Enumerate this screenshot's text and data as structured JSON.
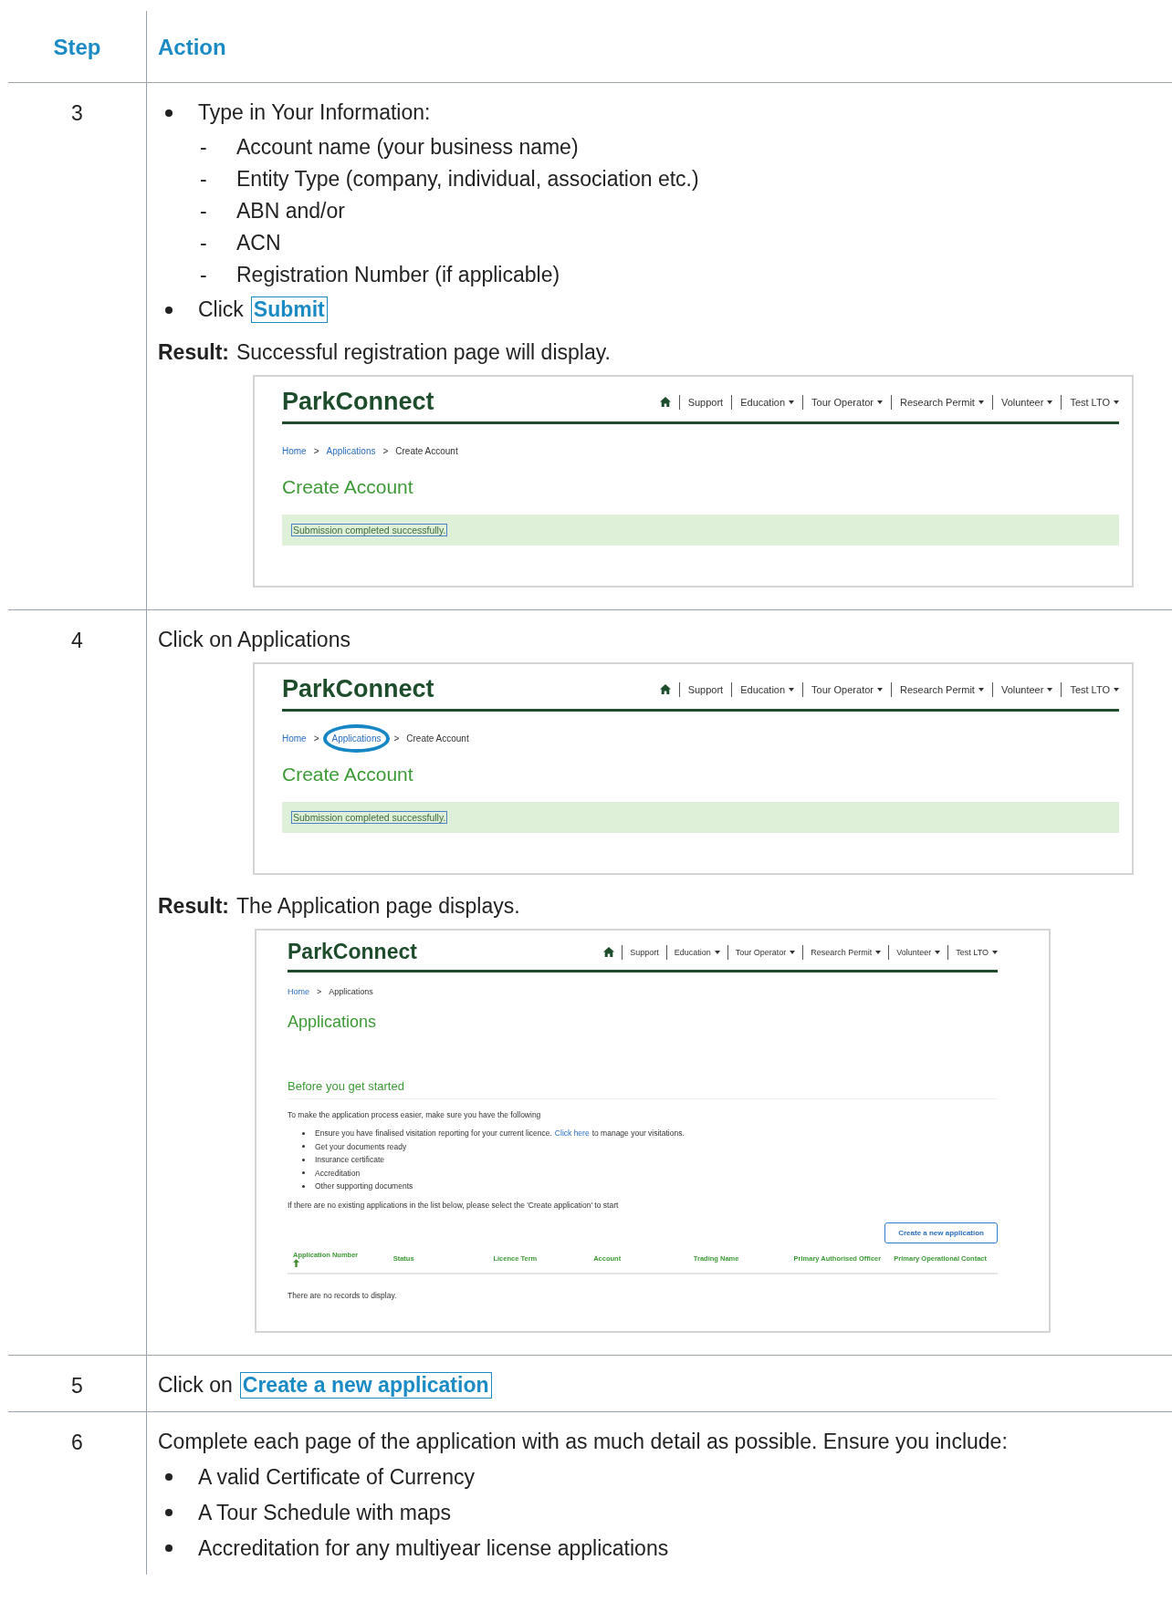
{
  "table": {
    "columns": [
      "Step",
      "Action"
    ],
    "rows": [
      {
        "step": "3",
        "blocks": [
          {
            "kind": "bullet",
            "text": "Type in Your Information:"
          },
          {
            "kind": "sublist",
            "marker": "-",
            "items": [
              "Account name (your business name)",
              "Entity Type (company, individual, association etc.)",
              "ABN and/or",
              "ACN",
              "Registration Number (if applicable)"
            ]
          },
          {
            "kind": "bullet",
            "text": "Click",
            "button": "Submit"
          },
          {
            "kind": "result",
            "label": "Result:",
            "text": "Successful registration page will display."
          },
          {
            "kind": "screenshot",
            "logo": "ParkConnect",
            "nav": [
              {
                "label": "Support",
                "dropdown": false
              },
              {
                "label": "Education",
                "dropdown": true
              },
              {
                "label": "Tour Operator",
                "dropdown": true
              },
              {
                "label": "Research Permit",
                "dropdown": true
              },
              {
                "label": "Volunteer",
                "dropdown": true
              },
              {
                "label": "Test LTO",
                "dropdown": true
              }
            ],
            "breadcrumb": [
              {
                "label": "Home",
                "link": true,
                "circled": false,
                "separator": ">"
              },
              {
                "label": "Applications",
                "link": true,
                "circled": false,
                "separator": ">"
              },
              {
                "label": "Create Account",
                "link": false,
                "circled": false
              }
            ],
            "heading": "Create Account",
            "message": "Submission completed successfully."
          }
        ]
      },
      {
        "step": "4",
        "blocks": [
          {
            "kind": "text",
            "text": "Click on Applications"
          },
          {
            "kind": "screenshot",
            "logo": "ParkConnect",
            "nav": [
              {
                "label": "Support",
                "dropdown": false
              },
              {
                "label": "Education",
                "dropdown": true
              },
              {
                "label": "Tour Operator",
                "dropdown": true
              },
              {
                "label": "Research Permit",
                "dropdown": true
              },
              {
                "label": "Volunteer",
                "dropdown": true
              },
              {
                "label": "Test LTO",
                "dropdown": true
              }
            ],
            "breadcrumb": [
              {
                "label": "Home",
                "link": true,
                "circled": false,
                "separator": ">"
              },
              {
                "label": "Applications",
                "link": true,
                "circled": true,
                "separator": ">"
              },
              {
                "label": "Create Account",
                "link": false,
                "circled": false
              }
            ],
            "heading": "Create Account",
            "message": "Submission completed successfully."
          },
          {
            "kind": "result",
            "label": "Result:",
            "text": "The Application page displays."
          },
          {
            "kind": "screenshot",
            "logo": "ParkConnect",
            "nav": [
              {
                "label": "Support",
                "dropdown": false
              },
              {
                "label": "Education",
                "dropdown": true
              },
              {
                "label": "Tour Operator",
                "dropdown": true
              },
              {
                "label": "Research Permit",
                "dropdown": true
              },
              {
                "label": "Volunteer",
                "dropdown": true
              },
              {
                "label": "Test LTO",
                "dropdown": true
              }
            ],
            "breadcrumb": [
              {
                "label": "Home",
                "link": true,
                "circled": false,
                "separator": ">"
              },
              {
                "label": "Applications",
                "link": false,
                "circled": false
              }
            ],
            "heading": "Applications",
            "section": {
              "title": "Before you get started",
              "intro": "To make the application process easier, make sure you have the following",
              "items": [
                {
                  "text": "Ensure you have finalised visitation reporting for your current licence.",
                  "link": "Click here",
                  "after": "to manage your visitations."
                },
                {
                  "text": "Get your documents ready"
                },
                {
                  "text": "Insurance certificate"
                },
                {
                  "text": "Accreditation"
                },
                {
                  "text": "Other supporting documents"
                }
              ],
              "note": "If there are no existing applications in the list below, please select the 'Create application' to start",
              "button": "Create a new application",
              "columns": [
                {
                  "label": "Application Number",
                  "sorted": true
                },
                {
                  "label": "Status",
                  "sorted": false
                },
                {
                  "label": "Licence Term",
                  "sorted": false
                },
                {
                  "label": "Account",
                  "sorted": false
                },
                {
                  "label": "Trading Name",
                  "sorted": false
                },
                {
                  "label": "Primary Authorised Officer",
                  "sorted": false
                },
                {
                  "label": "Primary Operational Contact",
                  "sorted": false
                }
              ],
              "empty": "There are no records to display."
            }
          }
        ]
      },
      {
        "step": "5",
        "blocks": [
          {
            "kind": "text",
            "text": "Click on",
            "button": "Create a new application"
          }
        ]
      },
      {
        "step": "6",
        "blocks": [
          {
            "kind": "text",
            "text": "Complete each page of the application with as much detail as possible. Ensure you include:"
          },
          {
            "kind": "bullet",
            "text": "A valid Certificate of Currency"
          },
          {
            "kind": "bullet",
            "text": "A Tour Schedule with maps"
          },
          {
            "kind": "bullet",
            "text": "Accreditation for any multiyear license applications"
          }
        ]
      }
    ]
  }
}
